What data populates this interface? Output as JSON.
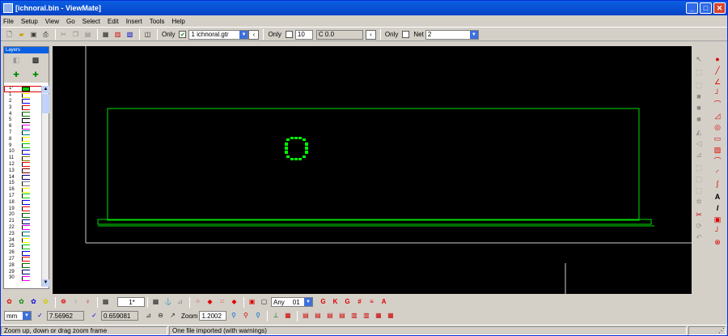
{
  "window": {
    "title": "[ichnoral.bin - ViewMate]",
    "min": "_",
    "max": "□",
    "close": "✕"
  },
  "menu": [
    "File",
    "Setup",
    "View",
    "Go",
    "Select",
    "Edit",
    "Insert",
    "Tools",
    "Help"
  ],
  "toolbar": {
    "only_label_1": "Only",
    "layer_select": "1  ichnoral.gtr",
    "only_label_2": "Only",
    "dcode_value": "10",
    "dcode_box": "C 0.0",
    "only_label_3": "Only",
    "net_label": "Net",
    "net_value": "2"
  },
  "layers": {
    "panel_title": "Layers",
    "rows": [
      {
        "num": "1*",
        "color": "#00cc00",
        "selected": true
      },
      {
        "num": "1",
        "color": "#ffff00"
      },
      {
        "num": "2",
        "color": "#0000ff"
      },
      {
        "num": "3",
        "color": "#ff0000"
      },
      {
        "num": "4",
        "color": "#008000"
      },
      {
        "num": "5",
        "color": "#000000"
      },
      {
        "num": "6",
        "color": "#ff00ff"
      },
      {
        "num": "7",
        "color": "#008080"
      },
      {
        "num": "8",
        "color": "#ffff00"
      },
      {
        "num": "9",
        "color": "#00cc00"
      },
      {
        "num": "10",
        "color": "#0000ff"
      },
      {
        "num": "11",
        "color": "#808000"
      },
      {
        "num": "12",
        "color": "#ff0000"
      },
      {
        "num": "13",
        "color": "#800000"
      },
      {
        "num": "14",
        "color": "#000080"
      },
      {
        "num": "15",
        "color": "#808080"
      },
      {
        "num": "16",
        "color": "#ffff00"
      },
      {
        "num": "17",
        "color": "#00cc00"
      },
      {
        "num": "18",
        "color": "#0000ff"
      },
      {
        "num": "19",
        "color": "#ff0000"
      },
      {
        "num": "20",
        "color": "#008000"
      },
      {
        "num": "21",
        "color": "#000080"
      },
      {
        "num": "22",
        "color": "#ff00ff"
      },
      {
        "num": "23",
        "color": "#008080"
      },
      {
        "num": "24",
        "color": "#ffff00"
      },
      {
        "num": "25",
        "color": "#00cc00"
      },
      {
        "num": "26",
        "color": "#0000ff"
      },
      {
        "num": "27",
        "color": "#ff0000"
      },
      {
        "num": "28",
        "color": "#008000"
      },
      {
        "num": "29",
        "color": "#000080"
      },
      {
        "num": "30",
        "color": "#ff00ff"
      }
    ]
  },
  "bottom": {
    "mode_box": "1*",
    "view_select": "Any",
    "view_value": "01",
    "units_select": "mm",
    "x_coord": "7.56962",
    "y_coord": "0.659081",
    "zoom_label": "Zoom",
    "zoom_value": "1.2002"
  },
  "status": {
    "hint": "Zoom up, down or drag zoom frame",
    "message": "One file imported (with warnings)"
  },
  "colors": {
    "board_outline": "#00dd00",
    "pad": "#00ff00",
    "canvas_bg": "#000000",
    "frame": "#cccccc"
  }
}
